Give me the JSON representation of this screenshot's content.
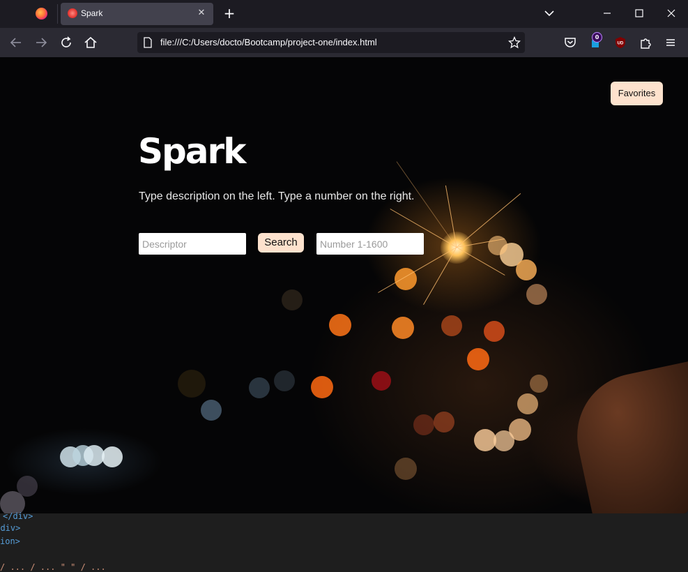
{
  "browser": {
    "tab": {
      "title": "Spark"
    },
    "url": "file:///C:/Users/docto/Bootcamp/project-one/index.html",
    "toolbar_badge": "0",
    "extension_ublock_label": "UD"
  },
  "page": {
    "favorites_label": "Favorites",
    "title": "Spark",
    "subtitle": "Type description on the left. Type a number on the right.",
    "descriptor_placeholder": "Descriptor",
    "search_label": "Search",
    "number_placeholder": "Number 1-1600"
  },
  "devtools": {
    "lines": [
      "</div>",
      "</div>",
      "ion>",
      "/ ... / ... \" \" / ... "
    ]
  },
  "colors": {
    "button_bg": "#fde2cd",
    "chrome_dark": "#1c1b22",
    "chrome_nav": "#2b2a33",
    "tab_active": "#42414d"
  },
  "icons": [
    "firefox-icon",
    "tab-favicon",
    "close-icon",
    "plus-icon",
    "chevron-down-icon",
    "minimize-icon",
    "maximize-icon",
    "close-window-icon",
    "back-icon",
    "forward-icon",
    "reload-icon",
    "home-icon",
    "page-icon",
    "star-icon",
    "pocket-icon",
    "extension-icon",
    "ublock-icon",
    "puzzle-icon",
    "menu-icon"
  ]
}
